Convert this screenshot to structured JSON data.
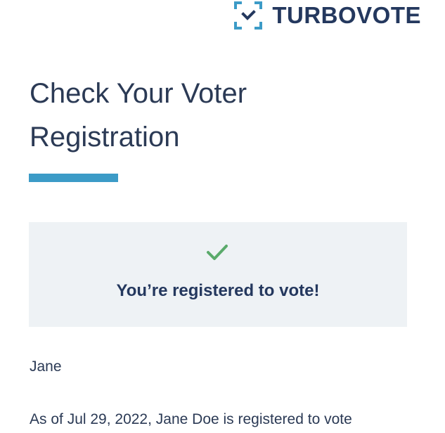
{
  "header": {
    "brand_name": "TURBOVOTE",
    "logo_icon": "turbovote-bracket-check-icon"
  },
  "main": {
    "title": "Check Your Voter Registration",
    "status": {
      "icon": "check-icon",
      "message": "You’re registered to vote!"
    },
    "first_name": "Jane",
    "detail_text": "As of Jul 29, 2022, Jane Doe is registered to vote"
  },
  "colors": {
    "brand_navy": "#24385e",
    "accent_blue": "#3c9bc7",
    "success_green": "#5aaa6b",
    "panel_background": "#eef2f5"
  }
}
